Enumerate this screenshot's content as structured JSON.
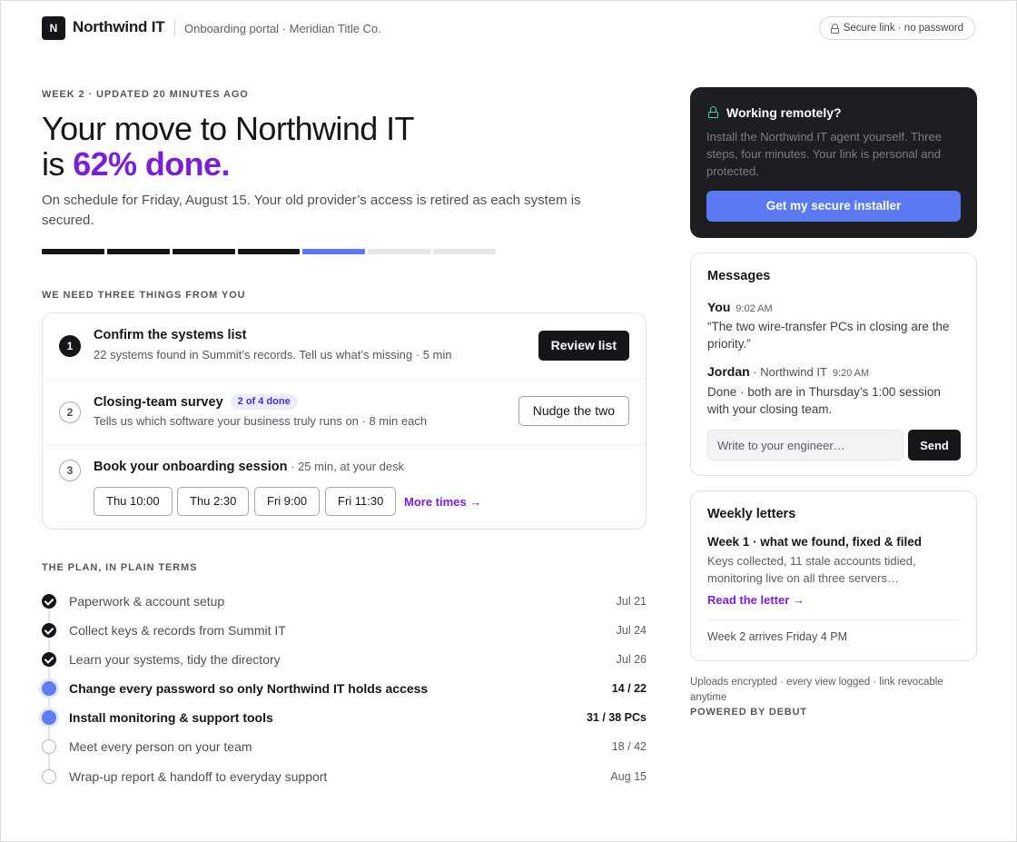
{
  "header": {
    "logo_letter": "N",
    "brand": "Northwind IT",
    "subtitle": "Onboarding portal · Meridian Title Co.",
    "secure_label": "Secure link · no password"
  },
  "hero": {
    "eyebrow": "WEEK 2 · UPDATED 20 MINUTES AGO",
    "title_line1": "Your move to Northwind IT",
    "title_prefix": "is ",
    "title_highlight": "62% done.",
    "lead": "On schedule for Friday, August 15. Your old provider’s access is retired as each system is secured.",
    "progress_segments": [
      "complete",
      "complete",
      "complete",
      "complete",
      "active",
      "pending",
      "pending"
    ]
  },
  "tasks": {
    "heading": "WE NEED THREE THINGS FROM YOU",
    "items": [
      {
        "number": "1",
        "title": "Confirm the systems list",
        "subtitle": "22 systems found in Summit’s records. Tell us what’s missing · 5 min",
        "button": "Review list"
      },
      {
        "number": "2",
        "title": "Closing-team survey",
        "badge": "2 of 4 done",
        "subtitle": "Tells us which software your business truly runs on · 8 min each",
        "button": "Nudge the two"
      },
      {
        "number": "3",
        "title": "Book your onboarding session",
        "meta": " · 25 min, at your desk",
        "slots": [
          "Thu 10:00",
          "Thu 2:30",
          "Fri 9:00",
          "Fri 11:30"
        ],
        "more": "More times →"
      }
    ]
  },
  "plan": {
    "heading": "THE PLAN, IN PLAIN TERMS",
    "steps": [
      {
        "label": "Paperwork & account setup",
        "value": "Jul 21",
        "status": "done"
      },
      {
        "label": "Collect keys & records from Summit IT",
        "value": "Jul 24",
        "status": "done"
      },
      {
        "label": "Learn your systems, tidy the directory",
        "value": "Jul 26",
        "status": "done"
      },
      {
        "label": "Change every password so only Northwind IT holds access",
        "value": "14 / 22",
        "status": "active"
      },
      {
        "label": "Install monitoring & support tools",
        "value": "31 / 38 PCs",
        "status": "active"
      },
      {
        "label": "Meet every person on your team",
        "value": "18 / 42",
        "status": "todo"
      },
      {
        "label": "Wrap-up report & handoff to everyday support",
        "value": "Aug 15",
        "status": "todo"
      }
    ]
  },
  "remote": {
    "title": "Working remotely?",
    "body": "Install the Northwind IT agent yourself. Three steps, four minutes. Your link is personal and protected.",
    "button": "Get my secure installer"
  },
  "messages": {
    "title": "Messages",
    "items": [
      {
        "author": "You",
        "org": "",
        "time": "9:02 AM",
        "text": "“The two wire-transfer PCs in closing are the priority.”"
      },
      {
        "author": "Jordan",
        "org": " · Northwind IT",
        "time": "9:20 AM",
        "text": "Done · both are in Thursday’s 1:00 session with your closing team."
      }
    ],
    "input_placeholder": "Write to your engineer…",
    "send": "Send"
  },
  "letters": {
    "title": "Weekly letters",
    "letter_title": "Week 1 · what we found, fixed & filed",
    "letter_body": "Keys collected, 11 stale accounts tidied, monitoring live on all three servers…",
    "link": "Read the letter →",
    "footer": "Week 2 arrives Friday 4 PM"
  },
  "footer": {
    "fine": "Uploads encrypted · every view logged · link revocable anytime",
    "powered": "POWERED BY DEBUT"
  },
  "colors": {
    "accent_purple": "#7a1fd6",
    "accent_blue": "#5a79f2",
    "dark": "#16161a",
    "lock_green": "#3ddc97"
  }
}
